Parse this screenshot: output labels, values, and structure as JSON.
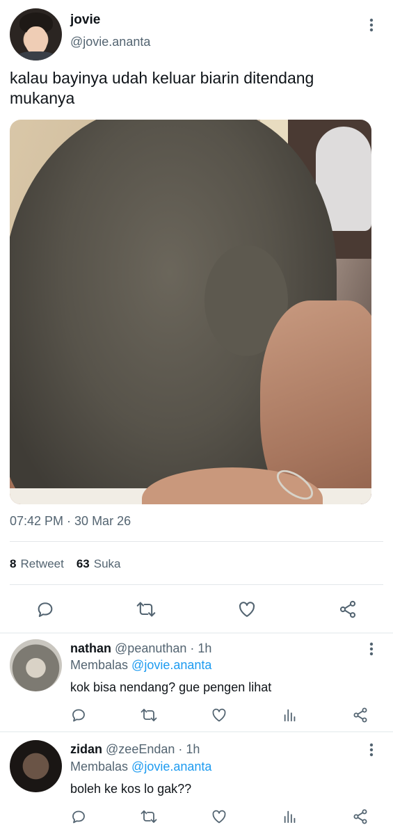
{
  "tweet": {
    "author": {
      "name": "jovie",
      "handle": "@jovie.ananta"
    },
    "text": "kalau bayinya udah keluar biarin ditendang mukanya",
    "timestamp": "07:42 PM · 30 Mar 26",
    "stats": {
      "retweets": "8",
      "retweet_label": "Retweet",
      "likes": "63",
      "like_label": "Suka"
    },
    "actions": [
      "reply-icon",
      "retweet-icon",
      "like-icon",
      "share-icon"
    ]
  },
  "replies": [
    {
      "name": "nathan",
      "handle": "@peanuthan",
      "time": "· 1h",
      "replying_prefix": "Membalas",
      "replying_to": "@jovie.ananta",
      "text": "kok bisa nendang? gue pengen lihat",
      "actions": [
        "reply-icon",
        "retweet-icon",
        "like-icon",
        "analytics-icon",
        "share-icon"
      ]
    },
    {
      "name": "zidan",
      "handle": "@zeeEndan",
      "time": "· 1h",
      "replying_prefix": "Membalas",
      "replying_to": "@jovie.ananta",
      "text": "boleh ke kos lo gak??",
      "actions": [
        "reply-icon",
        "retweet-icon",
        "like-icon",
        "analytics-icon",
        "share-icon"
      ]
    }
  ],
  "colors": {
    "text": "#0f1419",
    "secondary": "#536471",
    "link": "#1d9bf0",
    "divider": "#e3e7ea"
  }
}
